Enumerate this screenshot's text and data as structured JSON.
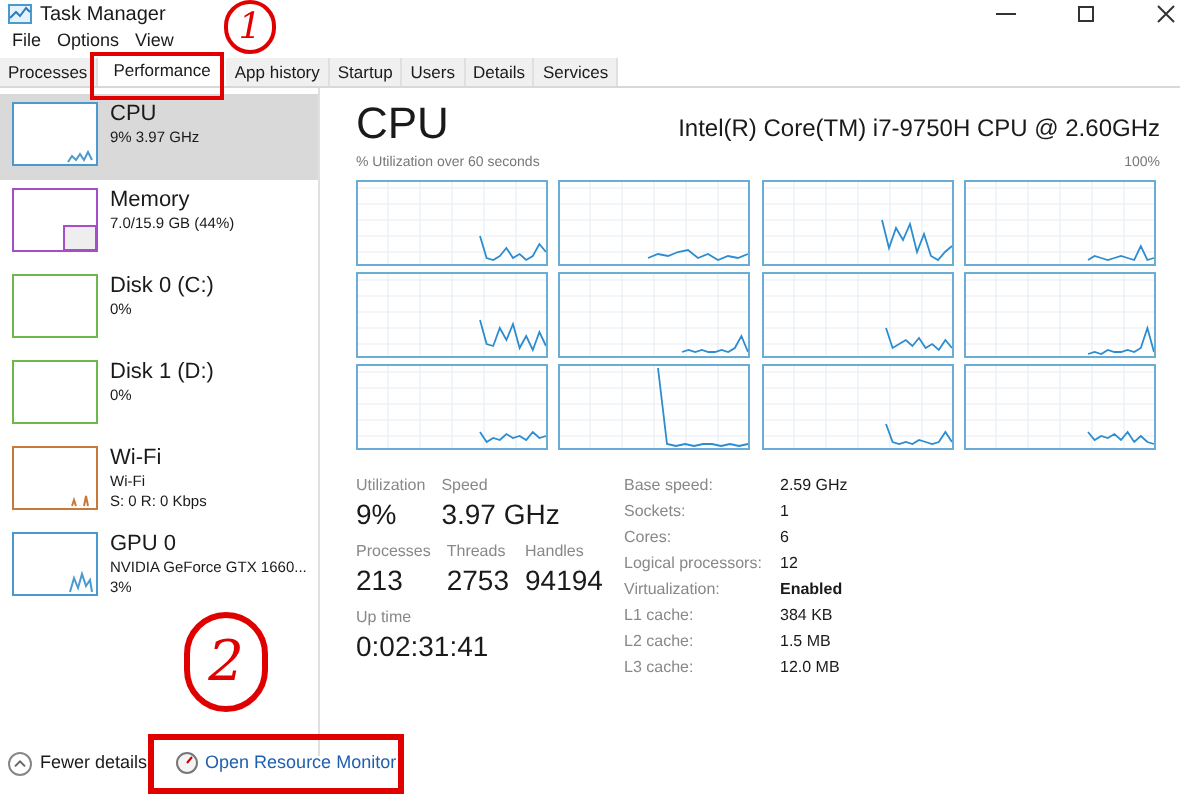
{
  "window": {
    "title": "Task Manager"
  },
  "menu": [
    "File",
    "Options",
    "View"
  ],
  "tabs": [
    {
      "label": "Processes",
      "selected": false
    },
    {
      "label": "Performance",
      "selected": true
    },
    {
      "label": "App history",
      "selected": false
    },
    {
      "label": "Startup",
      "selected": false
    },
    {
      "label": "Users",
      "selected": false
    },
    {
      "label": "Details",
      "selected": false
    },
    {
      "label": "Services",
      "selected": false
    }
  ],
  "sidebar": {
    "items": [
      {
        "name": "CPU",
        "lines": [
          "9% 3.97 GHz"
        ],
        "color": "#4a9ad0",
        "selected": true
      },
      {
        "name": "Memory",
        "lines": [
          "7.0/15.9 GB (44%)"
        ],
        "color": "#a64dc8",
        "selected": false
      },
      {
        "name": "Disk 0 (C:)",
        "lines": [
          "0%"
        ],
        "color": "#6cb84a",
        "selected": false
      },
      {
        "name": "Disk 1 (D:)",
        "lines": [
          "0%"
        ],
        "color": "#6cb84a",
        "selected": false
      },
      {
        "name": "Wi-Fi",
        "lines": [
          "Wi-Fi",
          "S: 0 R: 0 Kbps"
        ],
        "color": "#c8793a",
        "selected": false
      },
      {
        "name": "GPU 0",
        "lines": [
          "NVIDIA GeForce GTX 1660...",
          "3%"
        ],
        "color": "#4a9ad0",
        "selected": false
      }
    ]
  },
  "detail": {
    "title": "CPU",
    "model": "Intel(R) Core(TM) i7-9750H CPU @ 2.60GHz",
    "graph_caption": "% Utilization over 60 seconds",
    "graph_max": "100%",
    "stats": [
      [
        {
          "label": "Utilization",
          "value": "9%"
        },
        {
          "label": "Speed",
          "value": "3.97 GHz"
        }
      ],
      [
        {
          "label": "Processes",
          "value": "213"
        },
        {
          "label": "Threads",
          "value": "2753"
        },
        {
          "label": "Handles",
          "value": "94194"
        }
      ],
      [
        {
          "label": "Up time",
          "value": "0:02:31:41"
        }
      ]
    ],
    "specs": [
      {
        "label": "Base speed:",
        "value": "2.59 GHz"
      },
      {
        "label": "Sockets:",
        "value": "1"
      },
      {
        "label": "Cores:",
        "value": "6"
      },
      {
        "label": "Logical processors:",
        "value": "12"
      },
      {
        "label": "Virtualization:",
        "value": "Enabled",
        "bold": true
      },
      {
        "label": "L1 cache:",
        "value": "384 KB"
      },
      {
        "label": "L2 cache:",
        "value": "1.5 MB"
      },
      {
        "label": "L3 cache:",
        "value": "12.0 MB"
      }
    ]
  },
  "footer": {
    "fewer_details": "Fewer details",
    "resource_monitor": "Open Resource Monitor"
  },
  "annotations": [
    {
      "label": "1"
    },
    {
      "label": "2"
    }
  ]
}
